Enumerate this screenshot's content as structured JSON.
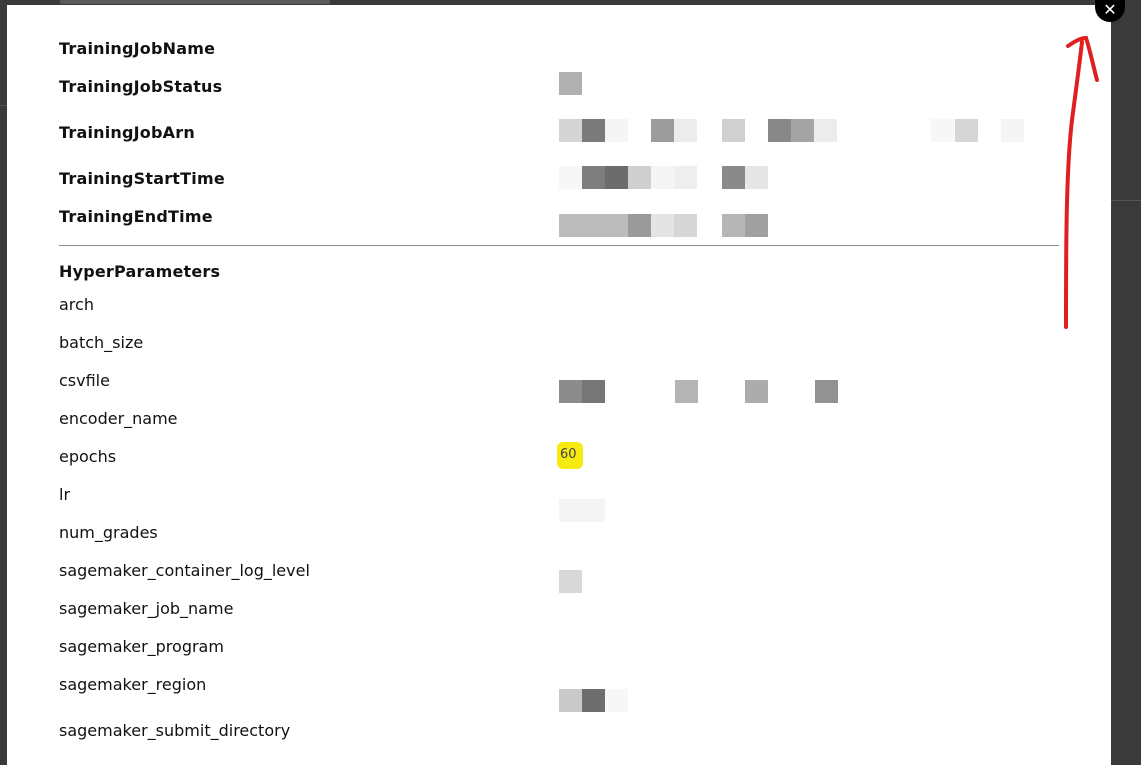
{
  "modal": {
    "close_label": "✕",
    "job_fields": [
      {
        "label": "TrainingJobName"
      },
      {
        "label": "TrainingJobStatus"
      },
      {
        "label": "TrainingJobArn"
      },
      {
        "label": "TrainingStartTime"
      },
      {
        "label": "TrainingEndTime"
      }
    ],
    "hyperparameters_heading": "HyperParameters",
    "hyperparameters": [
      {
        "label": "arch"
      },
      {
        "label": "batch_size"
      },
      {
        "label": "csvfile"
      },
      {
        "label": "encoder_name"
      },
      {
        "label": "epochs",
        "value": "60"
      },
      {
        "label": "lr"
      },
      {
        "label": "num_grades"
      },
      {
        "label": "sagemaker_container_log_level"
      },
      {
        "label": "sagemaker_job_name"
      },
      {
        "label": "sagemaker_program"
      },
      {
        "label": "sagemaker_region"
      },
      {
        "label": "sagemaker_submit_directory"
      }
    ]
  },
  "colors": {
    "highlight": "#f5ea12",
    "annotation_arrow": "#e02020",
    "overlay": "#3a3a3a"
  },
  "annotation": {
    "icon": "red-arrow-pointing-to-close"
  }
}
